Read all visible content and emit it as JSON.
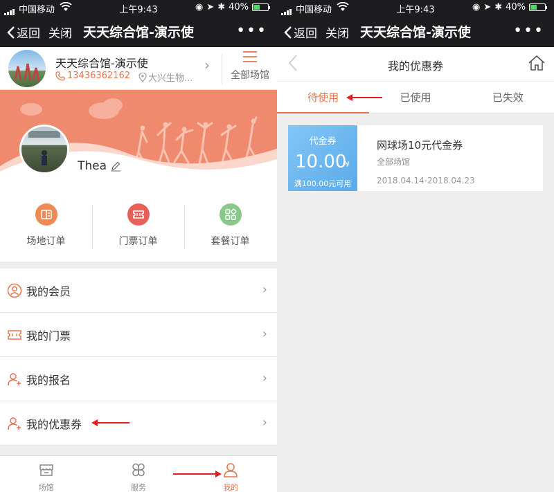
{
  "status": {
    "carrier": "中国移动",
    "time": "上午9:43",
    "battery": "40%"
  },
  "nav": {
    "back": "返回",
    "close": "关闭",
    "title": "天天综合馆-演示使"
  },
  "venue": {
    "name": "天天综合馆-演示使",
    "phone": "13436362162",
    "address": "大兴生物...",
    "all_label": "全部场馆"
  },
  "profile": {
    "username": "Thea"
  },
  "orders": [
    {
      "label": "场地订单",
      "color": "#ef8a56"
    },
    {
      "label": "门票订单",
      "color": "#e8605a"
    },
    {
      "label": "套餐订单",
      "color": "#88c888"
    }
  ],
  "menu": [
    {
      "label": "我的会员",
      "icon": "member-icon"
    },
    {
      "label": "我的门票",
      "icon": "ticket-icon"
    },
    {
      "label": "我的报名",
      "icon": "signup-icon"
    },
    {
      "label": "我的优惠券",
      "icon": "coupon-icon"
    }
  ],
  "tabbar": [
    {
      "label": "场馆",
      "icon": "venue-icon"
    },
    {
      "label": "服务",
      "icon": "service-icon"
    },
    {
      "label": "我的",
      "icon": "profile-icon",
      "active": true
    }
  ],
  "coupons_page": {
    "title": "我的优惠券",
    "tabs": [
      {
        "label": "待使用",
        "active": true
      },
      {
        "label": "已使用"
      },
      {
        "label": "已失效"
      }
    ],
    "coupon": {
      "type": "代金券",
      "amount": "10.00",
      "currency": "¥",
      "condition": "满100.00元可用",
      "name": "网球场10元代金券",
      "scope": "全部场馆",
      "dates": "2018.04.14-2018.04.23"
    }
  },
  "colors": {
    "accent": "#e8734a",
    "banner": "#ef8a6e",
    "coupon_blue": "#5aaaea",
    "navbar": "#1d1d1f",
    "annotation_arrow": "#e02020"
  }
}
